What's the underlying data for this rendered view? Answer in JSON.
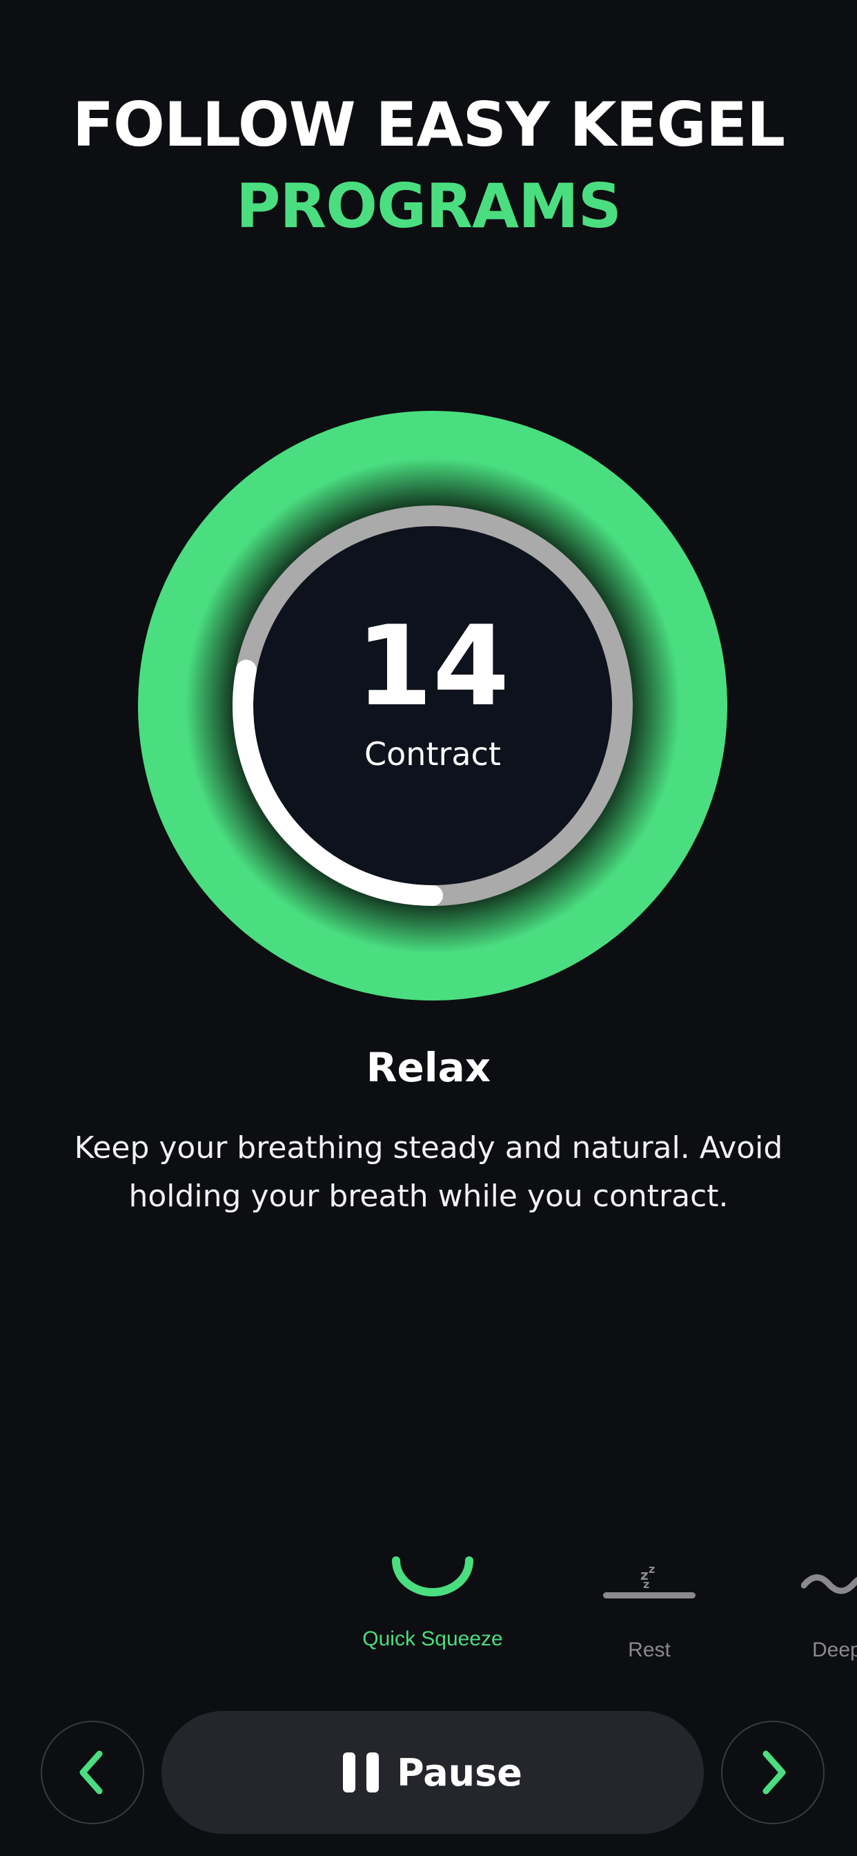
{
  "headline": {
    "line1": "FOLLOW EASY KEGEL",
    "line2": "PROGRAMS"
  },
  "timer": {
    "count": "14",
    "phase": "Contract",
    "progress": 0.28
  },
  "step": {
    "title": "Relax",
    "text": "Keep your breathing steady and natural. Avoid holding your breath while you contract."
  },
  "exercises": [
    {
      "label": "Quick Squeeze",
      "icon": "smile-arc-icon",
      "active": true
    },
    {
      "label": "Rest",
      "icon": "sleep-icon",
      "active": false
    },
    {
      "label": "Deep",
      "icon": "wave-icon",
      "active": false
    }
  ],
  "controls": {
    "pause_label": "Pause"
  },
  "colors": {
    "accent": "#4ade80",
    "background": "#0d0e11",
    "button": "#24262b",
    "muted": "#8a8a8e"
  }
}
